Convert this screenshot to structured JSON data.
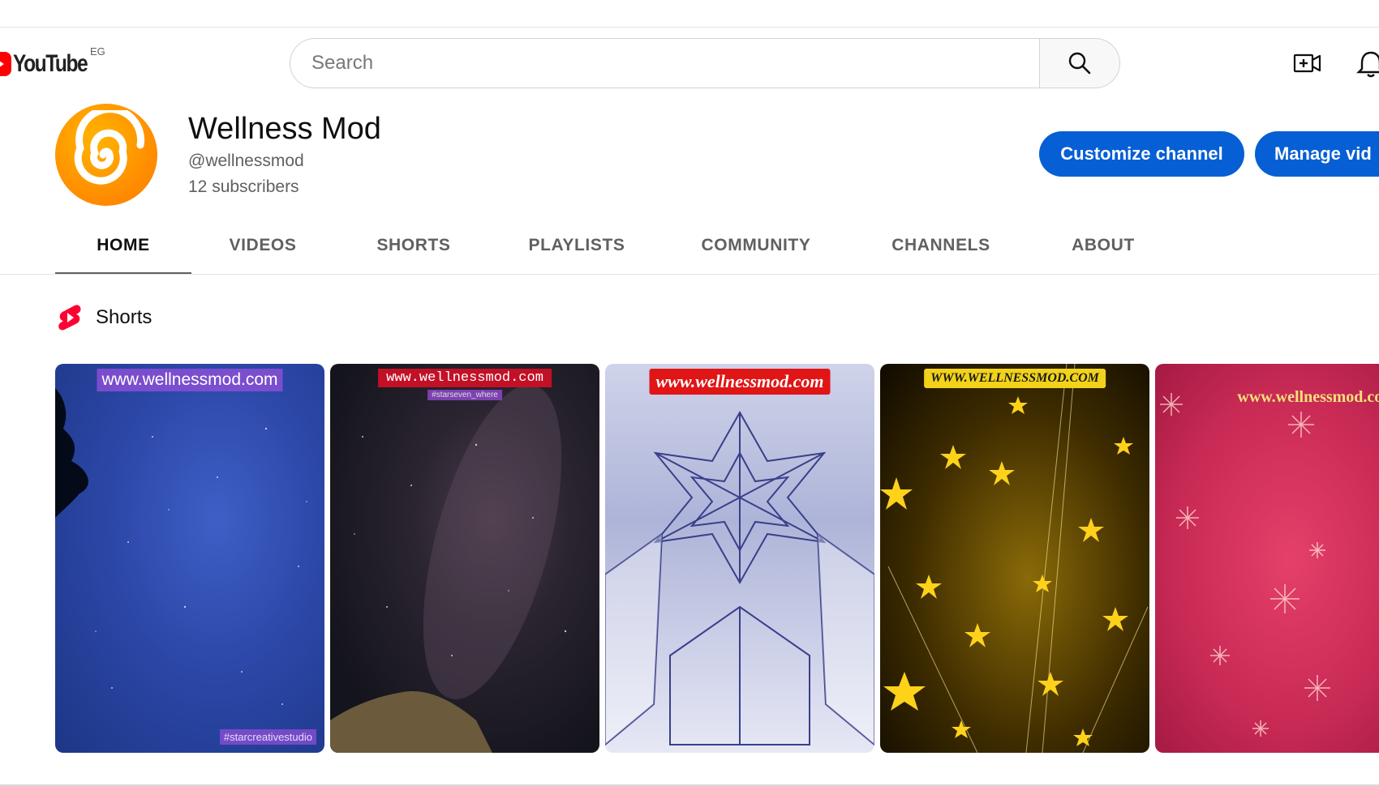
{
  "header": {
    "logo_text": "YouTube",
    "country_code": "EG",
    "search_placeholder": "Search"
  },
  "channel": {
    "name": "Wellness Mod",
    "handle": "@wellnessmod",
    "subscribers": "12 subscribers",
    "customize_label": "Customize channel",
    "manage_label": "Manage vid"
  },
  "tabs": [
    {
      "label": "HOME",
      "active": true
    },
    {
      "label": "VIDEOS"
    },
    {
      "label": "SHORTS"
    },
    {
      "label": "PLAYLISTS"
    },
    {
      "label": "COMMUNITY"
    },
    {
      "label": "CHANNELS"
    },
    {
      "label": "ABOUT"
    }
  ],
  "shorts_section": {
    "title": "Shorts",
    "items": [
      {
        "overlay": "www.wellnessmod.com",
        "watermark": "#starcreativestudio"
      },
      {
        "overlay": "www.wellnessmod.com",
        "sub_overlay": "#starseven_where"
      },
      {
        "overlay": "www.wellnessmod.com"
      },
      {
        "overlay": "WWW.WELLNESSMOD.COM"
      },
      {
        "overlay": "www.wellnessmod.com"
      }
    ]
  },
  "colors": {
    "accent_blue": "#065fd4",
    "youtube_red": "#ff0000",
    "avatar_orange": "#ff8a00"
  }
}
